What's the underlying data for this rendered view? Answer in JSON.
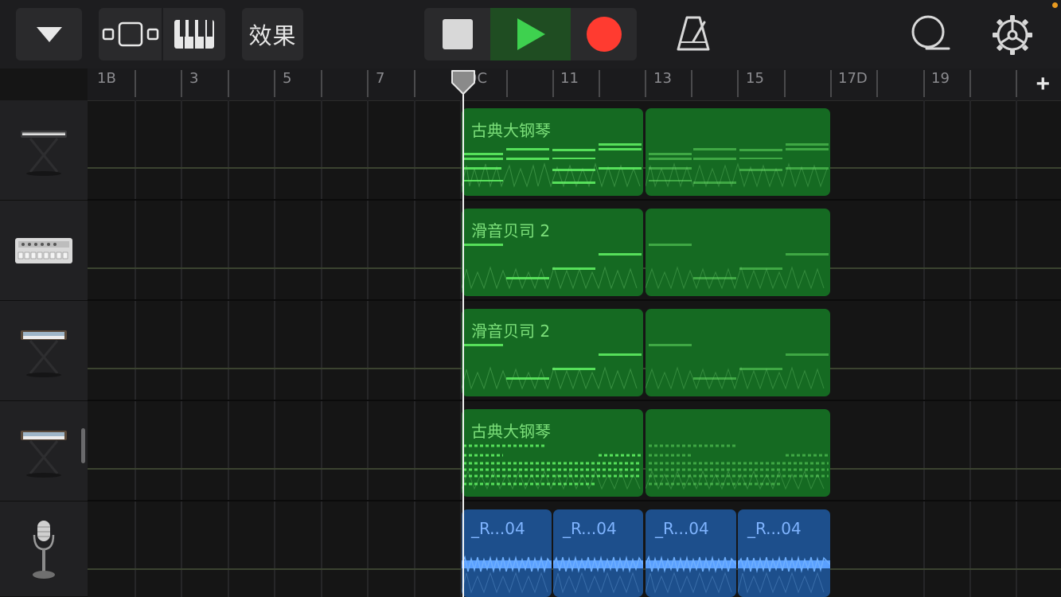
{
  "toolbar": {
    "view_menu_icon": "triangle-down-icon",
    "tracks_view_icon": "tracks-view-icon",
    "keyboard_icon": "piano-keyboard-icon",
    "fx_label": "效果",
    "stop_icon": "stop-icon",
    "play_icon": "play-icon",
    "record_icon": "record-icon",
    "metronome_icon": "metronome-icon",
    "loop_icon": "loop-icon",
    "settings_icon": "gear-icon",
    "colors": {
      "play_active": "#1f4d22",
      "play_glyph": "#3ed14f",
      "record": "#ff3b30"
    }
  },
  "ruler": {
    "labels": [
      "1B",
      "3",
      "5",
      "7",
      "9C",
      "11",
      "13",
      "15",
      "17D",
      "19"
    ],
    "add_label": "+"
  },
  "tracks": [
    {
      "instrument": "keyboard-stand-icon",
      "regions": [
        {
          "name": "古典大钢琴",
          "color": "green"
        },
        {
          "name": "",
          "color": "green"
        }
      ]
    },
    {
      "instrument": "drum-machine-icon",
      "regions": [
        {
          "name": "滑音贝司 2",
          "color": "green"
        },
        {
          "name": "",
          "color": "green"
        }
      ]
    },
    {
      "instrument": "synth-stand-icon",
      "regions": [
        {
          "name": "滑音贝司 2",
          "color": "green"
        },
        {
          "name": "",
          "color": "green"
        }
      ]
    },
    {
      "instrument": "synth-stand-icon",
      "regions": [
        {
          "name": "古典大钢琴",
          "color": "green"
        },
        {
          "name": "",
          "color": "green"
        }
      ]
    },
    {
      "instrument": "microphone-icon",
      "regions": [
        {
          "name": "_R...04",
          "color": "blue"
        },
        {
          "name": "_R...04",
          "color": "blue"
        },
        {
          "name": "_R...04",
          "color": "blue"
        },
        {
          "name": "_R...04",
          "color": "blue"
        }
      ]
    }
  ],
  "colors": {
    "accent_green": "#156a22",
    "note_green": "#56e05a",
    "audio_blue": "#1d4f8c",
    "playhead": "#f2f2f2"
  }
}
